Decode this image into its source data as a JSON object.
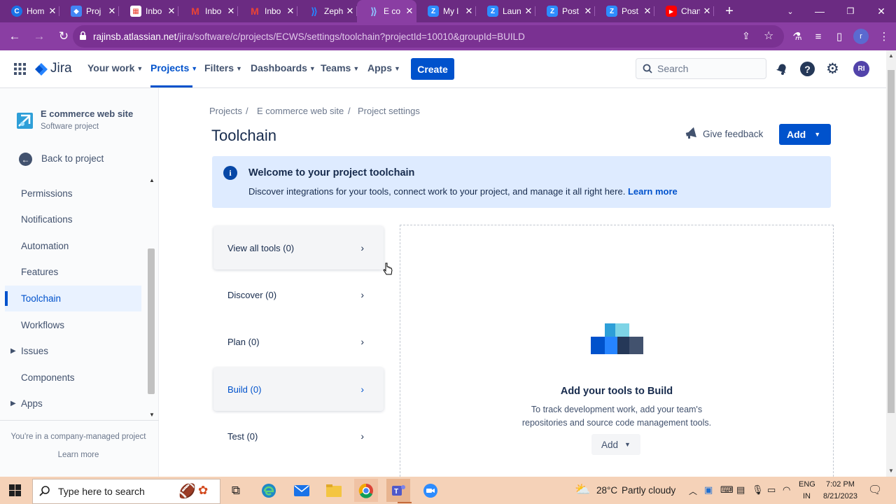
{
  "browser": {
    "tabs": [
      {
        "label": "Hom",
        "icon": "chrome-icon",
        "color": "#1a73e8"
      },
      {
        "label": "Proj",
        "icon": "shield-icon",
        "color": "#4285f4"
      },
      {
        "label": "Inbo",
        "icon": "calendar-icon",
        "color": "#ea4335"
      },
      {
        "label": "Inbo",
        "icon": "gmail-icon",
        "color": "#ea4335"
      },
      {
        "label": "Inbo",
        "icon": "gmail-icon",
        "color": "#ea4335"
      },
      {
        "label": "Zeph",
        "icon": "zephyr-icon",
        "color": "#2684ff"
      },
      {
        "label": "E co",
        "icon": "jira-icon",
        "color": "#2684ff"
      },
      {
        "label": "My l",
        "icon": "zoom-icon",
        "color": "#2d8cff"
      },
      {
        "label": "Laun",
        "icon": "zoom-icon",
        "color": "#2d8cff"
      },
      {
        "label": "Post",
        "icon": "zoom-icon",
        "color": "#2d8cff"
      },
      {
        "label": "Post",
        "icon": "zoom-icon",
        "color": "#2d8cff"
      },
      {
        "label": "Chan",
        "icon": "youtube-icon",
        "color": "#ff0000"
      }
    ],
    "url_host": "rajinsb.atlassian.net",
    "url_path": "/jira/software/c/projects/ECWS/settings/toolchain?projectId=10010&groupId=BUILD",
    "profile_initial": "r"
  },
  "jira_nav": {
    "logo": "Jira",
    "items": [
      "Your work",
      "Projects",
      "Filters",
      "Dashboards",
      "Teams",
      "Apps"
    ],
    "create": "Create",
    "search_placeholder": "Search",
    "avatar": "RI"
  },
  "sidebar": {
    "project_name": "E commerce web site",
    "project_type": "Software project",
    "back": "Back to project",
    "items": [
      "Permissions",
      "Notifications",
      "Automation",
      "Features",
      "Toolchain",
      "Workflows",
      "Issues",
      "Components",
      "Apps"
    ],
    "footer_text": "You're in a company-managed project",
    "footer_link": "Learn more"
  },
  "main": {
    "breadcrumbs": [
      "Projects",
      "E commerce web site",
      "Project settings"
    ],
    "title": "Toolchain",
    "feedback": "Give feedback",
    "add": "Add",
    "banner": {
      "title": "Welcome to your project toolchain",
      "text": "Discover integrations for your tools, connect work to your project, and manage it all right here.",
      "link": "Learn more"
    },
    "tool_list": [
      "View all tools (0)",
      "Discover (0)",
      "Plan (0)",
      "Build (0)",
      "Test (0)"
    ],
    "empty": {
      "title": "Add your tools to Build",
      "line1": "To track development work, add your team's",
      "line2": "repositories and source code management tools.",
      "add": "Add"
    }
  },
  "taskbar": {
    "search": "Type here to search",
    "weather_temp": "28°C",
    "weather_text": "Partly cloudy",
    "lang1": "ENG",
    "lang2": "IN",
    "time": "7:02 PM",
    "date": "8/21/2023"
  },
  "colors": {
    "chrome_frame": "#6b2b82",
    "jira_blue": "#0052cc",
    "banner_bg": "#deebff",
    "taskbar": "#f5d2b8"
  }
}
